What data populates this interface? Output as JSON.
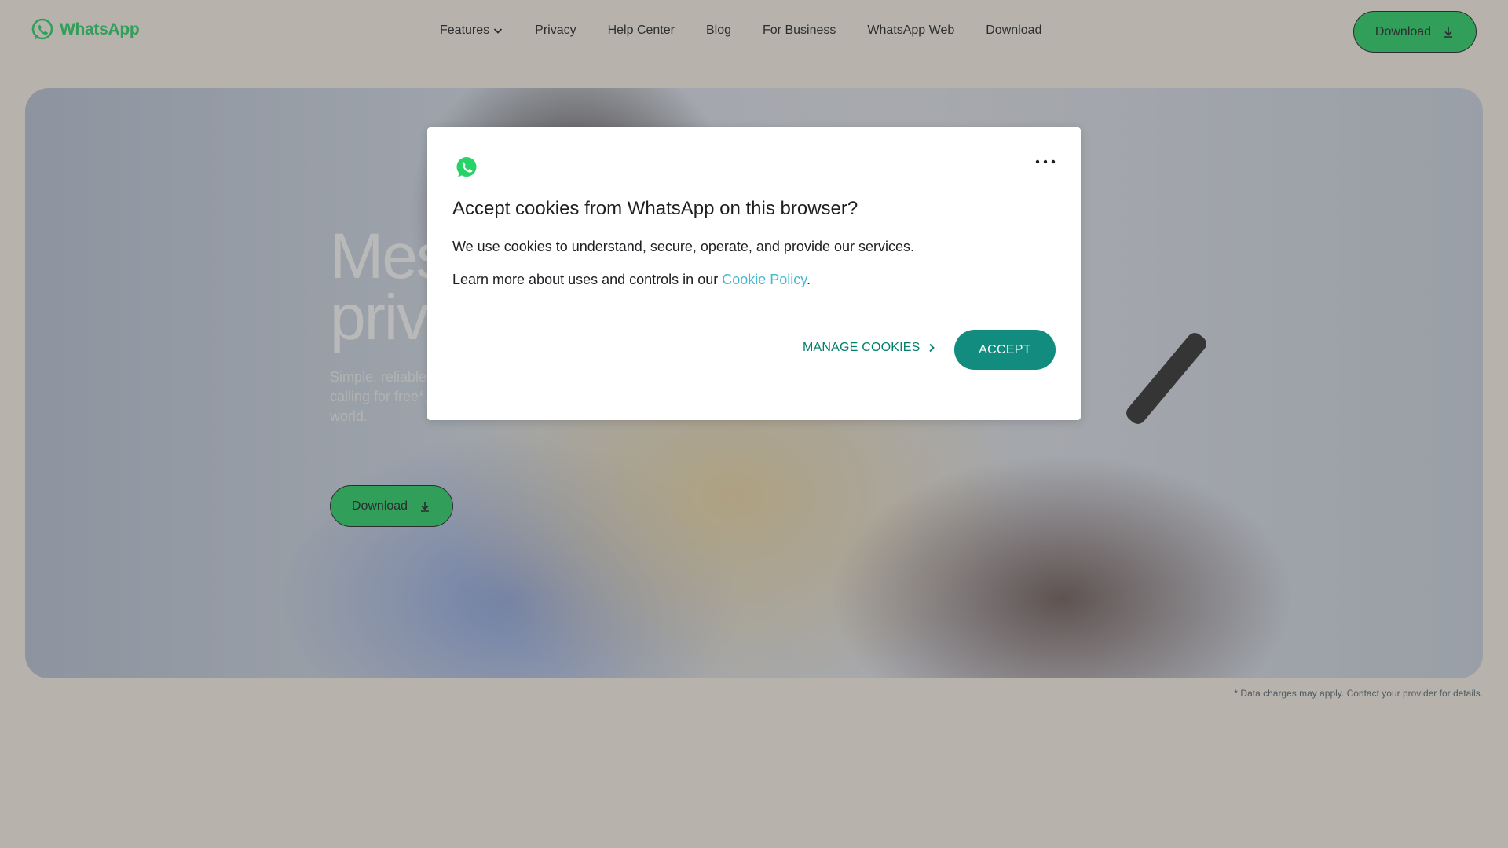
{
  "header": {
    "logo_text": "WhatsApp",
    "nav": [
      {
        "label": "Features"
      },
      {
        "label": "Privacy"
      },
      {
        "label": "Help Center"
      },
      {
        "label": "Blog"
      },
      {
        "label": "For Business"
      },
      {
        "label": "WhatsApp Web"
      },
      {
        "label": "Download"
      }
    ],
    "download_label": "Download"
  },
  "hero": {
    "title_line1": "Mes",
    "title_line2": "priva",
    "subtitle_line1": "Simple, reliable,",
    "subtitle_line2": "calling for free*,",
    "subtitle_line3": "world.",
    "download_label": "Download"
  },
  "disclaimer": "* Data charges may apply. Contact your provider for details.",
  "cookie_modal": {
    "title": "Accept cookies from WhatsApp on this browser?",
    "paragraph1": "We use cookies to understand, secure, operate, and provide our services.",
    "paragraph2_prefix": "Learn more about uses and controls in our ",
    "paragraph2_link": "Cookie Policy",
    "paragraph2_suffix": ".",
    "manage_label": "MANAGE COOKIES",
    "accept_label": "ACCEPT"
  },
  "colors": {
    "brand_green": "#25d366",
    "accept_teal": "#128c7e",
    "manage_teal": "#008069",
    "link_blue": "#45b7d1"
  },
  "icons": {
    "logo": "whatsapp-logo-icon",
    "features_chevron": "chevron-down-icon",
    "download": "download-icon",
    "more": "more-options-icon",
    "manage_chevron": "chevron-right-icon"
  }
}
